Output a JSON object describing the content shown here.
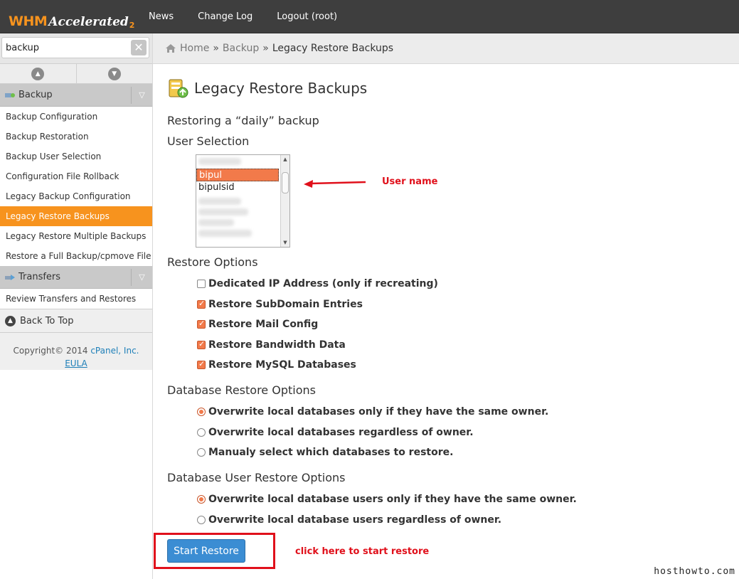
{
  "topbar": {
    "logo_main": "WHM",
    "logo_sub": "Accelerated",
    "logo_num": "2",
    "nav": [
      "News",
      "Change Log",
      "Logout (root)"
    ]
  },
  "sidebar": {
    "search": {
      "value": "backup",
      "placeholder": ""
    },
    "groups": [
      {
        "label": "Backup",
        "items": [
          "Backup Configuration",
          "Backup Restoration",
          "Backup User Selection",
          "Configuration File Rollback",
          "Legacy Backup Configuration",
          "Legacy Restore Backups",
          "Legacy Restore Multiple Backups",
          "Restore a Full Backup/cpmove File"
        ],
        "active_index": 5
      },
      {
        "label": "Transfers",
        "items": [
          "Review Transfers and Restores"
        ]
      }
    ],
    "back_to_top": "Back To Top",
    "copyright_prefix": "Copyright© 2014 ",
    "copyright_link": "cPanel, Inc.",
    "eula": "EULA"
  },
  "breadcrumb": {
    "home": "Home",
    "sep": "»",
    "section": "Backup",
    "current": "Legacy Restore Backups"
  },
  "main": {
    "title": "Legacy Restore Backups",
    "restoring": "Restoring a “daily” backup",
    "user_selection_heading": "User Selection",
    "users": [
      "bipul",
      "bipulsid"
    ],
    "selected_user": "bipul",
    "restore_options_heading": "Restore Options",
    "restore_options": [
      {
        "label": "Dedicated IP Address (only if recreating)",
        "checked": false
      },
      {
        "label": "Restore SubDomain Entries",
        "checked": true
      },
      {
        "label": "Restore Mail Config",
        "checked": true
      },
      {
        "label": "Restore Bandwidth Data",
        "checked": true
      },
      {
        "label": "Restore MySQL Databases",
        "checked": true
      }
    ],
    "db_restore_heading": "Database Restore Options",
    "db_restore_options": [
      {
        "label": "Overwrite local databases only if they have the same owner.",
        "checked": true
      },
      {
        "label": "Overwrite local databases regardless of owner.",
        "checked": false
      },
      {
        "label": "Manualy select which databases to restore.",
        "checked": false
      }
    ],
    "db_user_restore_heading": "Database User Restore Options",
    "db_user_restore_options": [
      {
        "label": "Overwrite local database users only if they have the same owner.",
        "checked": true
      },
      {
        "label": "Overwrite local database users regardless of owner.",
        "checked": false
      }
    ],
    "start_button": "Start Restore"
  },
  "annotations": {
    "user_name": "User name",
    "click_here": "click here to start restore",
    "color": "#e0101b"
  },
  "watermark": "hosthowto.com",
  "colors": {
    "accent": "#f7931e",
    "checked": "#f27a4a",
    "button": "#3b8dd3",
    "link": "#1e7fb8"
  }
}
